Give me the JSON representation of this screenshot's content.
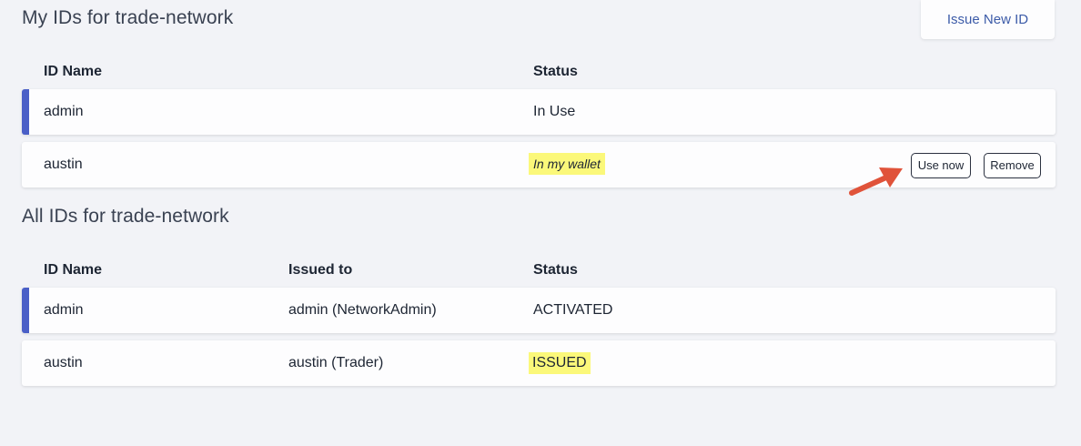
{
  "my_ids": {
    "title": "My IDs for trade-network",
    "issue_button": "Issue New ID",
    "headers": {
      "name": "ID Name",
      "status": "Status"
    },
    "rows": [
      {
        "name": "admin",
        "status": "In Use"
      },
      {
        "name": "austin",
        "status": "In my wallet",
        "use_now": "Use now",
        "remove": "Remove"
      }
    ]
  },
  "all_ids": {
    "title": "All IDs for trade-network",
    "headers": {
      "name": "ID Name",
      "issued_to": "Issued to",
      "status": "Status"
    },
    "rows": [
      {
        "name": "admin",
        "issued_to": "admin (NetworkAdmin)",
        "status": "ACTIVATED"
      },
      {
        "name": "austin",
        "issued_to": "austin (Trader)",
        "status": "ISSUED"
      }
    ]
  },
  "colors": {
    "selected_bar": "#4a5fc7",
    "highlight": "#fbf87a",
    "arrow": "#e0533a",
    "link": "#3c5ba8"
  }
}
